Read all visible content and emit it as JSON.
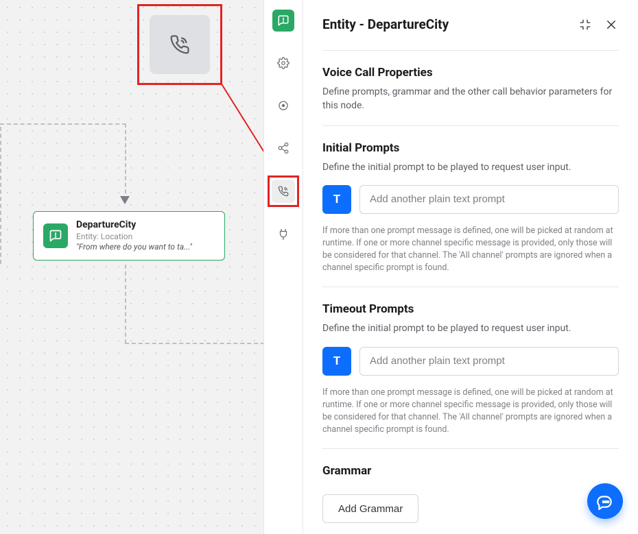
{
  "panel": {
    "title": "Entity - DepartureCity"
  },
  "node": {
    "title": "DepartureCity",
    "subtitle": "Entity: Location",
    "quote": "\"From where do you want to ta...\""
  },
  "rail": {
    "items": [
      "dialog-icon",
      "settings-icon",
      "record-icon",
      "share-icon",
      "voice-icon",
      "plug-icon"
    ]
  },
  "voice_section": {
    "title": "Voice Call Properties",
    "desc": "Define prompts, grammar and the other call behavior parameters for this node."
  },
  "initial": {
    "title": "Initial Prompts",
    "desc": "Define the initial prompt to be played to request user input.",
    "placeholder": "Add another plain text prompt",
    "hint": "If more than one prompt message is defined, one will be picked at random at runtime. If one or more channel specific message is provided, only those will be considered for that channel. The 'All channel' prompts are ignored when a channel specific prompt is found.",
    "t_label": "T"
  },
  "timeout": {
    "title": "Timeout Prompts",
    "desc": "Define the initial prompt to be played to request user input.",
    "placeholder": "Add another plain text prompt",
    "hint": "If more than one prompt message is defined, one will be picked at random at runtime. If one or more channel specific message is provided, only those will be considered for that channel. The 'All channel' prompts are ignored when a channel specific prompt is found.",
    "t_label": "T"
  },
  "grammar": {
    "title": "Grammar",
    "button": "Add Grammar"
  }
}
